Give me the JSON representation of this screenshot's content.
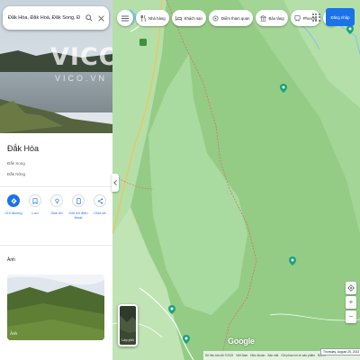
{
  "search": {
    "value": "Đắk Hòa, Đắk Hoà, Đắk Song, Đ"
  },
  "hero": {
    "watermark": "VICO",
    "watermark_sub": "VICO.VN"
  },
  "place": {
    "title": "Đắk Hòa",
    "line1": "Đắk Song",
    "line2": "Đắk Nông"
  },
  "actions": [
    {
      "label": "Chỉ đường",
      "icon": "directions-icon"
    },
    {
      "label": "Lưu",
      "icon": "bookmark-icon"
    },
    {
      "label": "Gần đó",
      "icon": "nearby-icon"
    },
    {
      "label": "Gửi tới điện thoại",
      "icon": "send-to-phone-icon"
    },
    {
      "label": "Chia sẻ",
      "icon": "share-icon"
    }
  ],
  "photos": {
    "title": "Ảnh",
    "photo_label": "Ảnh"
  },
  "chips": [
    {
      "label": "Nhà hàng",
      "icon": "restaurant-icon"
    },
    {
      "label": "Khách sạn",
      "icon": "hotel-icon"
    },
    {
      "label": "Điểm tham quan",
      "icon": "attraction-icon"
    },
    {
      "label": "Bảo tàng",
      "icon": "museum-icon"
    },
    {
      "label": "Phương",
      "icon": "transit-icon"
    }
  ],
  "signin": {
    "label": "Đăng nhập"
  },
  "layers": {
    "label": "Lớp phủ"
  },
  "zoom": {
    "in": "+",
    "out": "−"
  },
  "logo": "Google",
  "footer": {
    "items": [
      "Dữ liệu bản đồ ©2022",
      "Việt Nam",
      "Điều khoản",
      "Bảo mật",
      "Gửi phản hồi về sản phẩm",
      "500 m"
    ]
  },
  "date_badge": "Thursday, August 25, 2022",
  "colors": {
    "accent": "#1a73e8",
    "forest": "#9bd08a",
    "region": "#a9dba0",
    "boundary": "#e06b6b"
  }
}
